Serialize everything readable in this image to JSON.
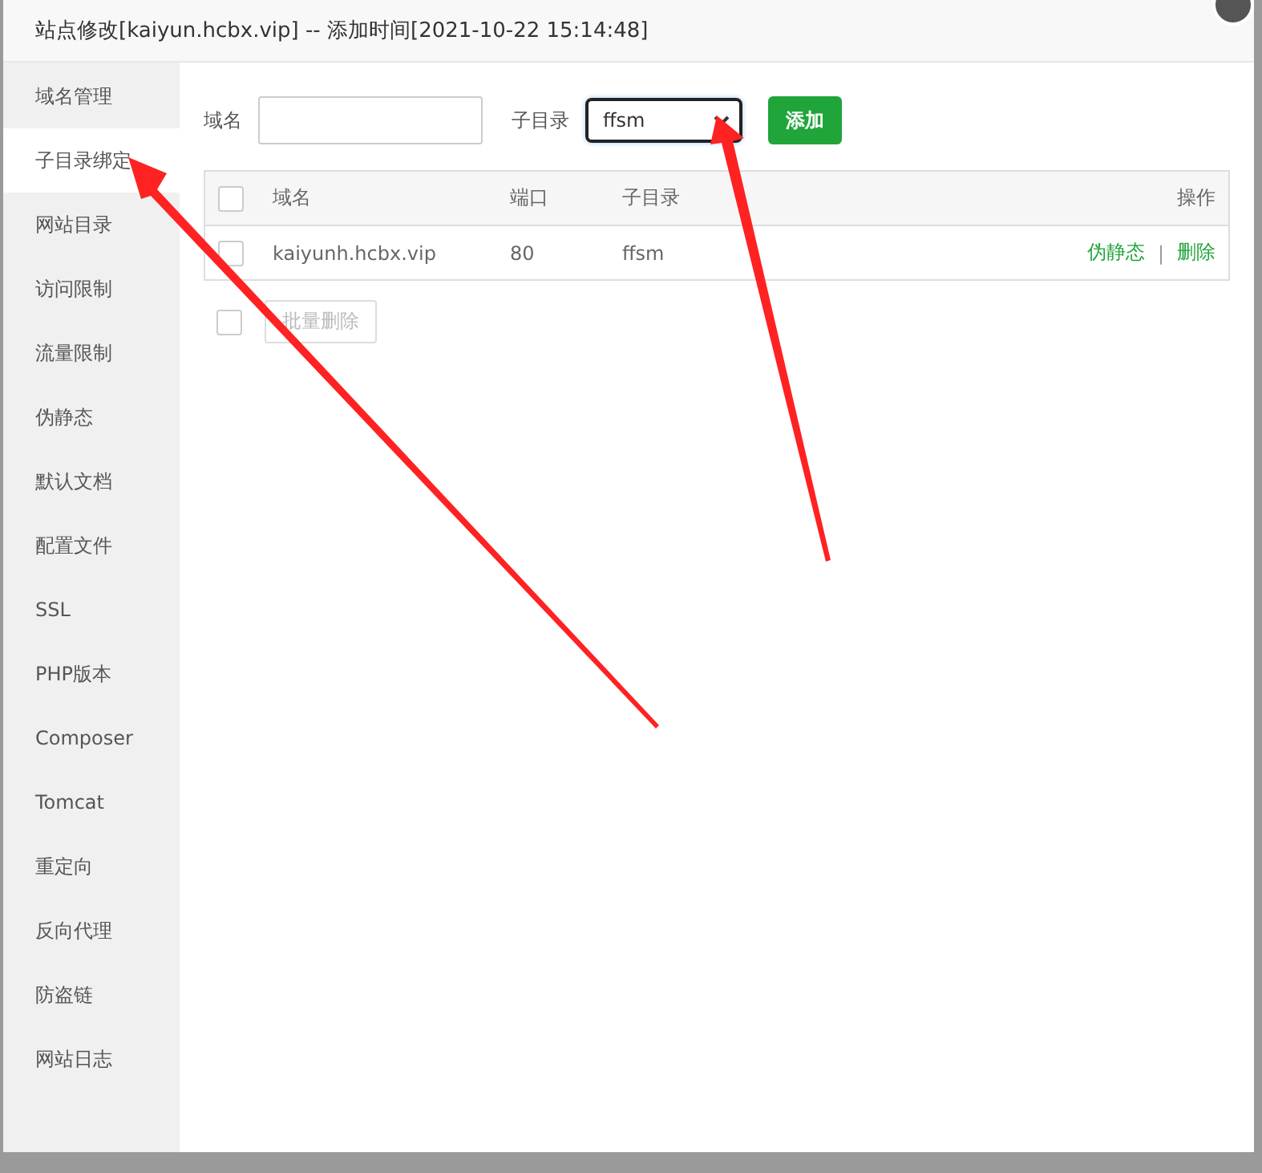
{
  "window": {
    "title": "站点修改[kaiyun.hcbx.vip] -- 添加时间[2021-10-22 15:14:48]"
  },
  "sidebar": {
    "items": [
      {
        "label": "域名管理",
        "selected": false
      },
      {
        "label": "子目录绑定",
        "selected": true
      },
      {
        "label": "网站目录",
        "selected": false
      },
      {
        "label": "访问限制",
        "selected": false
      },
      {
        "label": "流量限制",
        "selected": false
      },
      {
        "label": "伪静态",
        "selected": false
      },
      {
        "label": "默认文档",
        "selected": false
      },
      {
        "label": "配置文件",
        "selected": false
      },
      {
        "label": "SSL",
        "selected": false
      },
      {
        "label": "PHP版本",
        "selected": false
      },
      {
        "label": "Composer",
        "selected": false
      },
      {
        "label": "Tomcat",
        "selected": false
      },
      {
        "label": "重定向",
        "selected": false
      },
      {
        "label": "反向代理",
        "selected": false
      },
      {
        "label": "防盗链",
        "selected": false
      },
      {
        "label": "网站日志",
        "selected": false
      }
    ]
  },
  "form": {
    "domain_label": "域名",
    "subdir_label": "子目录",
    "subdir_value": "ffsm",
    "add_button": "添加"
  },
  "table": {
    "select_all_checked": false,
    "columns": [
      "域名",
      "端口",
      "子目录",
      "操作"
    ],
    "rows": [
      {
        "checked": false,
        "domain": "kaiyunh.hcbx.vip",
        "port": "80",
        "subdir": "ffsm",
        "actions": [
          "伪静态",
          "删除"
        ],
        "separator": "|"
      }
    ]
  },
  "batch": {
    "checked": false,
    "button": "批量删除"
  }
}
